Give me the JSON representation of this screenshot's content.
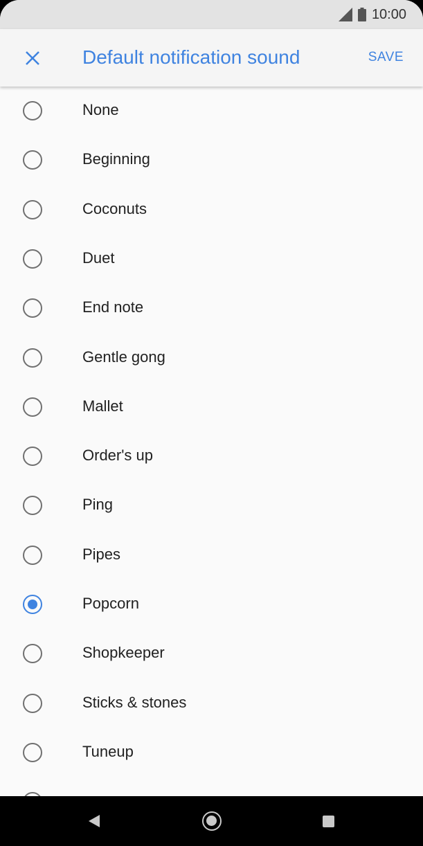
{
  "status_bar": {
    "time": "10:00",
    "icons": [
      "signal-icon",
      "battery-icon"
    ]
  },
  "app_bar": {
    "close_icon": "close-icon",
    "title": "Default notification sound",
    "save_label": "SAVE",
    "accent_color": "#3f83e0"
  },
  "sounds": [
    {
      "label": "None",
      "selected": false
    },
    {
      "label": "Beginning",
      "selected": false
    },
    {
      "label": "Coconuts",
      "selected": false
    },
    {
      "label": "Duet",
      "selected": false
    },
    {
      "label": "End note",
      "selected": false
    },
    {
      "label": "Gentle gong",
      "selected": false
    },
    {
      "label": "Mallet",
      "selected": false
    },
    {
      "label": "Order's up",
      "selected": false
    },
    {
      "label": "Ping",
      "selected": false
    },
    {
      "label": "Pipes",
      "selected": false
    },
    {
      "label": "Popcorn",
      "selected": true
    },
    {
      "label": "Shopkeeper",
      "selected": false
    },
    {
      "label": "Sticks & stones",
      "selected": false
    },
    {
      "label": "Tuneup",
      "selected": false
    },
    {
      "label": "",
      "selected": false
    }
  ],
  "nav_bar": {
    "icons": [
      "back-icon",
      "home-icon",
      "recents-icon"
    ]
  }
}
